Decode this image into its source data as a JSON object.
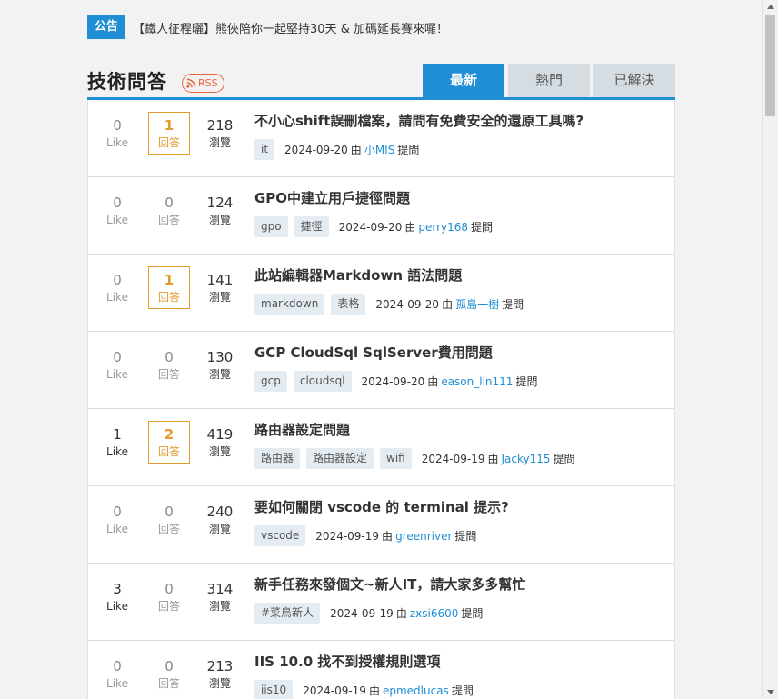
{
  "announcement": {
    "badge": "公告",
    "text": "【鐵人征程曬】熊俠陪你一起堅持30天 & 加碼延長賽來囉！"
  },
  "header": {
    "title": "技術問答",
    "rss_label": "RSS",
    "tabs": [
      {
        "label": "最新",
        "active": true
      },
      {
        "label": "熱門",
        "active": false
      },
      {
        "label": "已解決",
        "active": false
      }
    ]
  },
  "labels": {
    "like": "Like",
    "answer": "回答",
    "view": "瀏覽",
    "by": "由",
    "asked": "提問"
  },
  "questions": [
    {
      "likes": "0",
      "answers": "1",
      "views": "218",
      "title": "不小心shift誤刪檔案，請問有免費安全的還原工具嗎?",
      "tags": [
        "it"
      ],
      "date": "2024-09-20",
      "user": "小MIS"
    },
    {
      "likes": "0",
      "answers": "0",
      "views": "124",
      "title": "GPO中建立用戶捷徑問題",
      "tags": [
        "gpo",
        "捷徑"
      ],
      "date": "2024-09-20",
      "user": "perry168"
    },
    {
      "likes": "0",
      "answers": "1",
      "views": "141",
      "title": "此站編輯器Markdown 語法問題",
      "tags": [
        "markdown",
        "表格"
      ],
      "date": "2024-09-20",
      "user": "孤島一樹"
    },
    {
      "likes": "0",
      "answers": "0",
      "views": "130",
      "title": "GCP CloudSql SqlServer費用問題",
      "tags": [
        "gcp",
        "cloudsql"
      ],
      "date": "2024-09-20",
      "user": "eason_lin111"
    },
    {
      "likes": "1",
      "answers": "2",
      "views": "419",
      "title": "路由器設定問題",
      "tags": [
        "路由器",
        "路由器設定",
        "wifi"
      ],
      "date": "2024-09-19",
      "user": "Jacky115"
    },
    {
      "likes": "0",
      "answers": "0",
      "views": "240",
      "title": "要如何關閉 vscode 的 terminal 提示?",
      "tags": [
        "vscode"
      ],
      "date": "2024-09-19",
      "user": "greenriver"
    },
    {
      "likes": "3",
      "answers": "0",
      "views": "314",
      "title": "新手任務來發個文~新人IT，請大家多多幫忙",
      "tags": [
        "#菜鳥新人"
      ],
      "date": "2024-09-19",
      "user": "zxsi6600"
    },
    {
      "likes": "0",
      "answers": "0",
      "views": "213",
      "title": "IIS 10.0 找不到授權規則選項",
      "tags": [
        "iis10"
      ],
      "date": "2024-09-19",
      "user": "epmedlucas"
    }
  ],
  "colors": {
    "accent": "#1f8ed5",
    "answered": "#e59c2f",
    "rss": "#e8643c"
  }
}
